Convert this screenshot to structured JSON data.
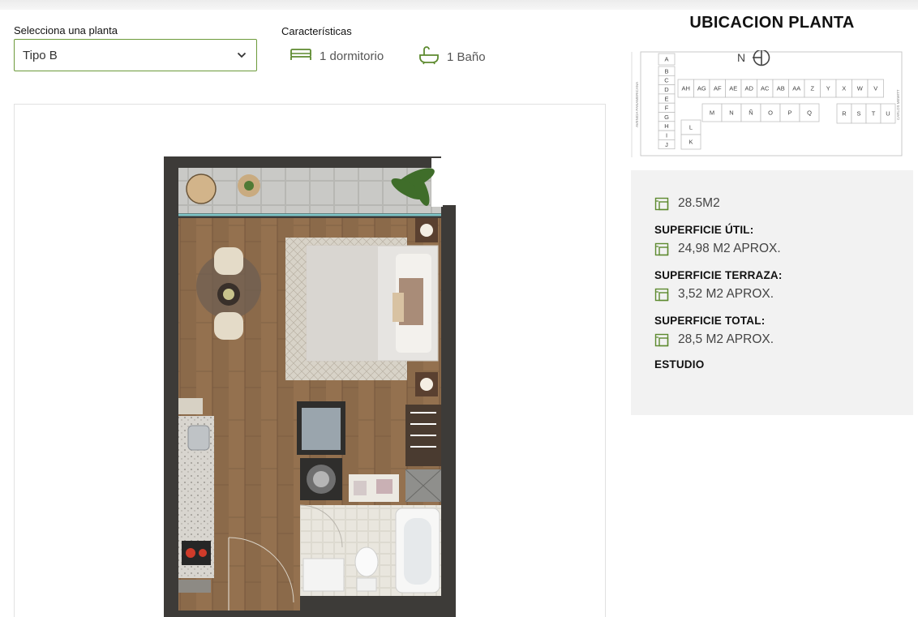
{
  "selector": {
    "label": "Selecciona una planta",
    "value": "Tipo B"
  },
  "features": {
    "label": "Características",
    "bedroom": "1 dormitorio",
    "bathroom": "1 Baño"
  },
  "location": {
    "title": "UBICACION PLANTA",
    "north_label": "N",
    "units_top": [
      "AH",
      "AG",
      "AF",
      "AE",
      "AD",
      "AC",
      "AB",
      "AA",
      "Z",
      "Y",
      "X",
      "W",
      "V"
    ],
    "units_left": [
      "A",
      "B",
      "C",
      "D",
      "E",
      "F",
      "G",
      "H",
      "I",
      "J"
    ],
    "units_middle": [
      "M",
      "N",
      "Ñ",
      "O",
      "P",
      "Q"
    ],
    "units_right": [
      "R",
      "S",
      "T",
      "U"
    ],
    "units_lower": [
      "L",
      "K"
    ],
    "street_left": "AVENIDA PANAMERICANA",
    "street_right": "CARLOS MEWITT"
  },
  "surfaces": {
    "headline": "28.5M2",
    "util_label": "SUPERFICIE ÚTIL:",
    "util_value": "24,98 M2 APROX.",
    "terraza_label": "SUPERFICIE TERRAZA:",
    "terraza_value": "3,52 M2 APROX.",
    "total_label": "SUPERFICIE TOTAL:",
    "total_value": "28,5 M2 APROX.",
    "type": "ESTUDIO"
  },
  "colors": {
    "accent_green": "#5d8a2f",
    "panel_bg": "#f2f2f2"
  },
  "icons": {
    "chevron": "chevron-down-icon",
    "bed": "bed-icon",
    "bath": "bathtub-icon",
    "area": "floor-area-icon",
    "north": "north-compass-icon"
  }
}
